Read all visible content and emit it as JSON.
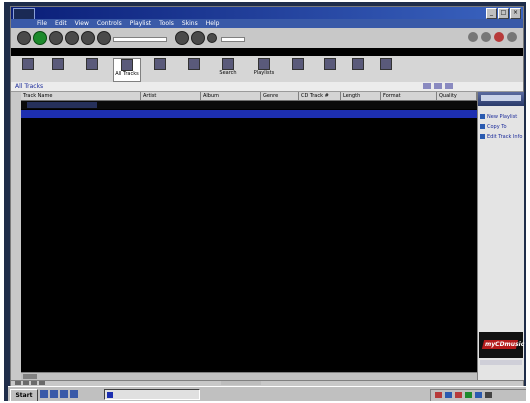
{
  "window": {
    "title": "",
    "buttons": [
      "_",
      "□",
      "×"
    ]
  },
  "menu": {
    "items": [
      "File",
      "Edit",
      "View",
      "Controls",
      "Playlist",
      "Tools",
      "Skins",
      "Help"
    ]
  },
  "toolbar": {
    "tools": [
      {
        "label": "",
        "icon": "back-icon"
      },
      {
        "label": "",
        "icon": "forward-icon"
      },
      {
        "label": "",
        "icon": "music-guide-icon"
      },
      {
        "label": "All Tracks",
        "icon": "all-tracks-icon"
      },
      {
        "label": "",
        "icon": "genre-icon"
      },
      {
        "label": "",
        "icon": "artist-icon"
      },
      {
        "label": "Search",
        "icon": "search-icon"
      },
      {
        "label": "Playlists",
        "icon": "playlists-icon"
      },
      {
        "label": "",
        "icon": "now-playing-icon"
      },
      {
        "label": "",
        "icon": "radio-icon"
      },
      {
        "label": "",
        "icon": "devices-icon"
      },
      {
        "label": "",
        "icon": "create-cd-icon"
      }
    ]
  },
  "breadcrumb": {
    "path": "All Tracks"
  },
  "list": {
    "columns": [
      "Track Name",
      "Artist",
      "Album",
      "Genre",
      "CD Track #",
      "Length",
      "Format",
      "Quality"
    ],
    "rows": [
      {
        "track": "",
        "artist": "",
        "album": "",
        "genre": "",
        "cd_track": "",
        "length": "",
        "format": "",
        "quality": ""
      }
    ]
  },
  "side_panel": {
    "items": [
      "New Playlist",
      "Copy To",
      "Edit Track Info"
    ],
    "logo": "myCDmusic"
  },
  "statusbar": {
    "text": ""
  },
  "taskbar": {
    "start": "Start",
    "task": ""
  },
  "colors": {
    "title_gradient_start": "#0a1e78",
    "selection": "#1d2fb0",
    "list_background": "#000000",
    "logo_red": "#b51c1c"
  }
}
